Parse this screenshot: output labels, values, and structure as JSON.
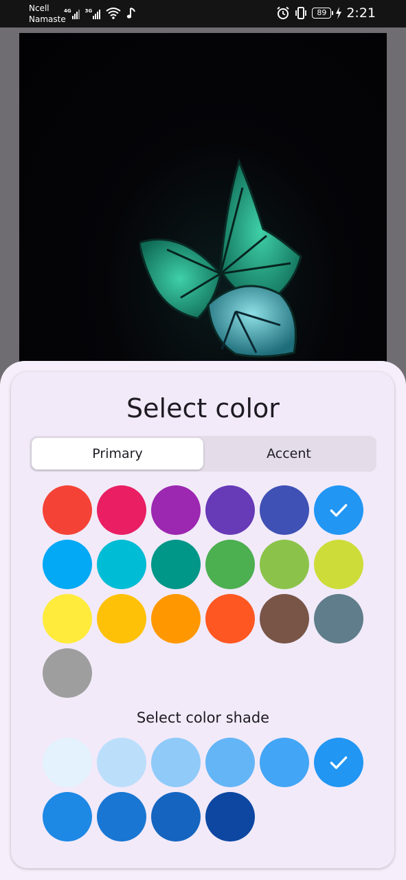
{
  "status_bar": {
    "carrier_line1": "Ncell",
    "carrier_line2": "Namaste",
    "network_1": "4G",
    "network_2": "3G",
    "battery": "89",
    "time": "2:21"
  },
  "dialog": {
    "title": "Select color",
    "tabs": [
      {
        "label": "Primary",
        "selected": true
      },
      {
        "label": "Accent",
        "selected": false
      }
    ],
    "shade_title": "Select color shade"
  },
  "colors": [
    "#f44336",
    "#e91e63",
    "#9c27b0",
    "#673ab7",
    "#3f51b5",
    "#2196f3",
    "#03a9f4",
    "#00bcd4",
    "#009688",
    "#4caf50",
    "#8bc34a",
    "#cddc39",
    "#ffeb3b",
    "#ffc107",
    "#ff9800",
    "#ff5722",
    "#795548",
    "#607d8b",
    "#9e9e9e"
  ],
  "selected_color_index": 5,
  "shades": [
    "#e3f2fd",
    "#bbdefb",
    "#90caf9",
    "#64b5f6",
    "#42a5f5",
    "#2196f3",
    "#1e88e5",
    "#1976d2",
    "#1565c0",
    "#0d47a1"
  ],
  "selected_shade_index": 5,
  "check_icon": "check-icon"
}
